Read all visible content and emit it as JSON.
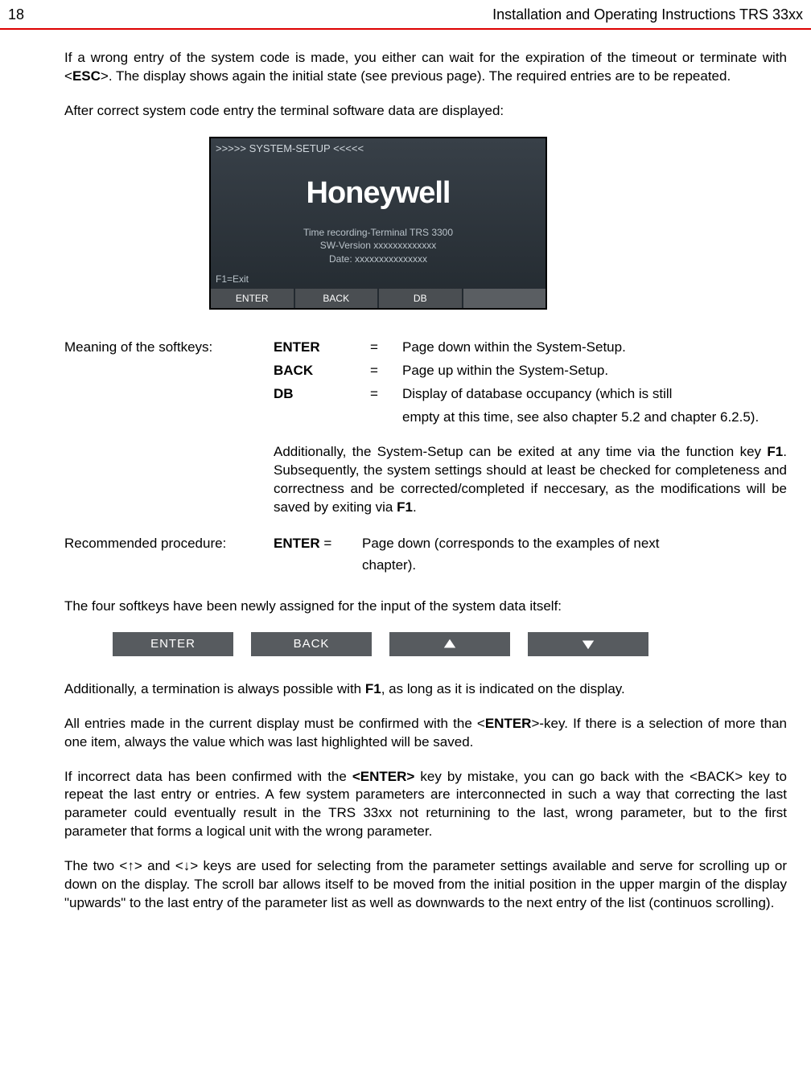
{
  "header": {
    "page_number": "18",
    "doc_title": "Installation  and Operating Instructions TRS 33xx"
  },
  "para1_a": "If a wrong entry of the system code is made, you either  can wait for the expiration of the timeout or terminate with <",
  "para1_esc": "ESC",
  "para1_b": ">. The display shows again the initial state (see previous page). The required entries are to be repeated.",
  "para2": "After correct system code entry the terminal software data are displayed:",
  "terminal": {
    "title": ">>>>> SYSTEM-SETUP <<<<<",
    "logo": "Honeywell",
    "line1": "Time recording-Terminal TRS 3300",
    "line2": "SW-Version xxxxxxxxxxxxx",
    "line3": "Date: xxxxxxxxxxxxxxx",
    "f1": "F1=Exit",
    "sk1": "ENTER",
    "sk2": "BACK",
    "sk3": "DB",
    "sk4": ""
  },
  "softkeys_label": "Meaning of the softkeys:",
  "sk_rows": [
    {
      "key": "ENTER",
      "eq": "=",
      "desc": "Page down within the System-Setup."
    },
    {
      "key": "BACK",
      "eq": "=",
      "desc": "Page up within the System-Setup."
    },
    {
      "key": "DB",
      "eq": "=",
      "desc": "Display of database occupancy (which is still"
    }
  ],
  "sk_db_cont": "empty at this time, see also chapter 5.2 and chapter 6.2.5).",
  "addl_a": "Additionally, the System-Setup can be exited at any time via the function key ",
  "addl_f1a": "F1",
  "addl_b": ". Subsequently, the system settings should at least be checked for completeness and correctness and be corrected/completed if neccesary, as the modifications will be saved by exiting via ",
  "addl_f1b": "F1",
  "addl_c": ".",
  "rec_label": "Recommended procedure:",
  "rec_key": "ENTER",
  "rec_eq": " =",
  "rec_desc": "Page down (corresponds to the examples of next",
  "rec_desc2": "chapter).",
  "para3": "The four softkeys have been newly assigned for the input of the system data itself:",
  "skrow": {
    "b1": "ENTER",
    "b2": "BACK"
  },
  "para4_a": "Additionally, a termination is always possible with ",
  "para4_f1": "F1",
  "para4_b": ", as long as it is indicated on the display.",
  "para5_a": "All entries made in the current display must be confirmed with the <",
  "para5_enter": "ENTER",
  "para5_b": ">-key. If there is a selection of more than one item, always the value which was last highlighted will be saved.",
  "para6_a": "If incorrect data has been confirmed with the ",
  "para6_enter": "<ENTER>",
  "para6_b": " key by mistake, you can go back with the <BACK> key to repeat the last entry or entries. A few system parameters are interconnected in such a way that correcting the last parameter could eventually result in the TRS 33xx not returnining to the last, wrong parameter, but to the first parameter that forms a logical unit with the wrong parameter.",
  "para7": "The two <↑> and <↓> keys are used for selecting from the parameter settings available and serve for scrolling up or down on the display. The scroll bar allows itself to be moved from the initial position in the upper margin of the display \"upwards\" to the last entry of the parameter list as well as downwards to the next entry of the list (continuos scrolling)."
}
